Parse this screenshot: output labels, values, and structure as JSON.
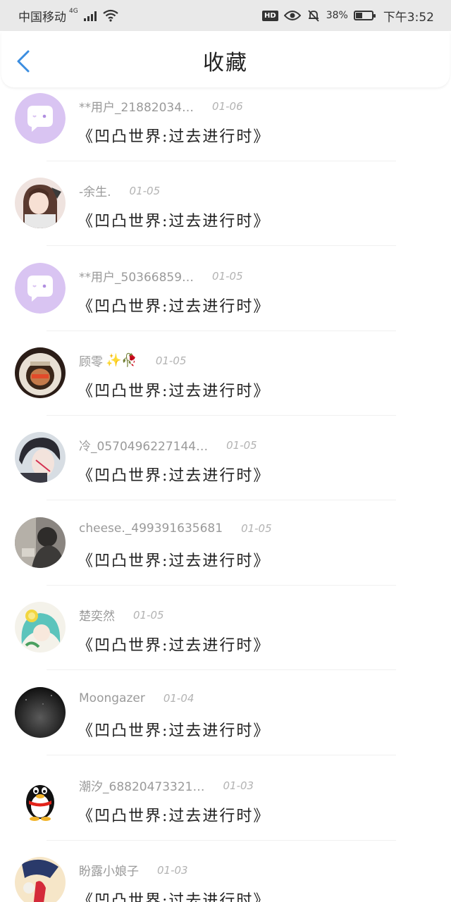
{
  "status_bar": {
    "carrier": "中国移动",
    "network": "4G",
    "battery": "38%",
    "time": "下午3:52"
  },
  "nav": {
    "title": "收藏",
    "back_icon": "chevron-left-icon"
  },
  "colors": {
    "accent": "#3b8de0",
    "default_avatar": "#d9c4f2"
  },
  "favorites": [
    {
      "user": "**用户_21882034…",
      "date": "01-06",
      "title": "《凹凸世界:过去进行时》",
      "avatar": "default-avatar"
    },
    {
      "user": "-余生.",
      "date": "01-05",
      "title": "《凹凸世界:过去进行时》",
      "avatar": "anime-girl-avatar"
    },
    {
      "user": "**用户_50366859…",
      "date": "01-05",
      "title": "《凹凸世界:过去进行时》",
      "avatar": "default-avatar"
    },
    {
      "user": "顾零",
      "emoji": "✨🥀",
      "date": "01-05",
      "title": "《凹凸世界:过去进行时》",
      "avatar": "astronaut-avatar"
    },
    {
      "user": "冷_0570496227144…",
      "date": "01-05",
      "title": "《凹凸世界:过去进行时》",
      "avatar": "anime-boy-avatar"
    },
    {
      "user": "cheese._499391635681",
      "date": "01-05",
      "title": "《凹凸世界:过去进行时》",
      "avatar": "photo-avatar"
    },
    {
      "user": "楚奕然",
      "date": "01-05",
      "title": "《凹凸世界:过去进行时》",
      "avatar": "lemon-girl-avatar"
    },
    {
      "user": "Moongazer",
      "date": "01-04",
      "title": "《凹凸世界:过去进行时》",
      "avatar": "dark-sky-avatar"
    },
    {
      "user": "潮汐_68820473321…",
      "date": "01-03",
      "title": "《凹凸世界:过去进行时》",
      "avatar": "qq-penguin-avatar"
    },
    {
      "user": "盼露小娘子",
      "date": "01-03",
      "title": "《凹凸世界:过去进行时》",
      "avatar": "illustration-avatar"
    }
  ]
}
